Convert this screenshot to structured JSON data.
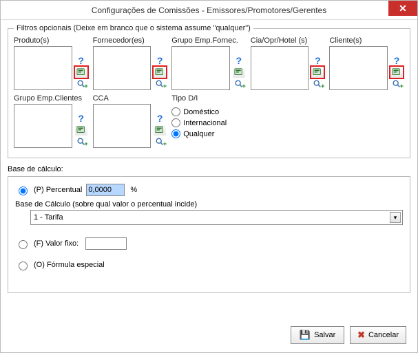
{
  "window": {
    "title": "Configurações de Comissões - Emissores/Promotores/Gerentes"
  },
  "filters": {
    "legend": "Filtros opcionais (Deixe em branco que o sistema assume \"qualquer\")",
    "row1": [
      {
        "label": "Produto(s)",
        "redbox": true
      },
      {
        "label": "Fornecedor(es)",
        "redbox": true
      },
      {
        "label": "Grupo Emp.Fornec.",
        "redbox": false
      },
      {
        "label": "Cia/Opr/Hotel (s)",
        "redbox": true
      },
      {
        "label": "Cliente(s)",
        "redbox": true
      }
    ],
    "row2": [
      {
        "label": "Grupo Emp.Clientes",
        "redbox": false
      },
      {
        "label": "CCA",
        "redbox": false
      }
    ],
    "tipo": {
      "label": "Tipo D/I",
      "options": [
        "Doméstico",
        "Internacional",
        "Qualquer"
      ],
      "selected": "Qualquer"
    }
  },
  "base": {
    "title": "Base de cálculo:",
    "percentual": {
      "label": "(P) Percentual",
      "value": "0,0000",
      "suffix": "%",
      "subtext": "Base de Cálculo (sobre qual valor o percentual incide)",
      "select_value": "1 - Tarifa"
    },
    "valorfixo": {
      "label": "(F) Valor fixo:",
      "value": ""
    },
    "formula": {
      "label": "(O) Fórmula especial"
    },
    "selected": "percentual"
  },
  "buttons": {
    "save": "Salvar",
    "cancel": "Cancelar"
  }
}
